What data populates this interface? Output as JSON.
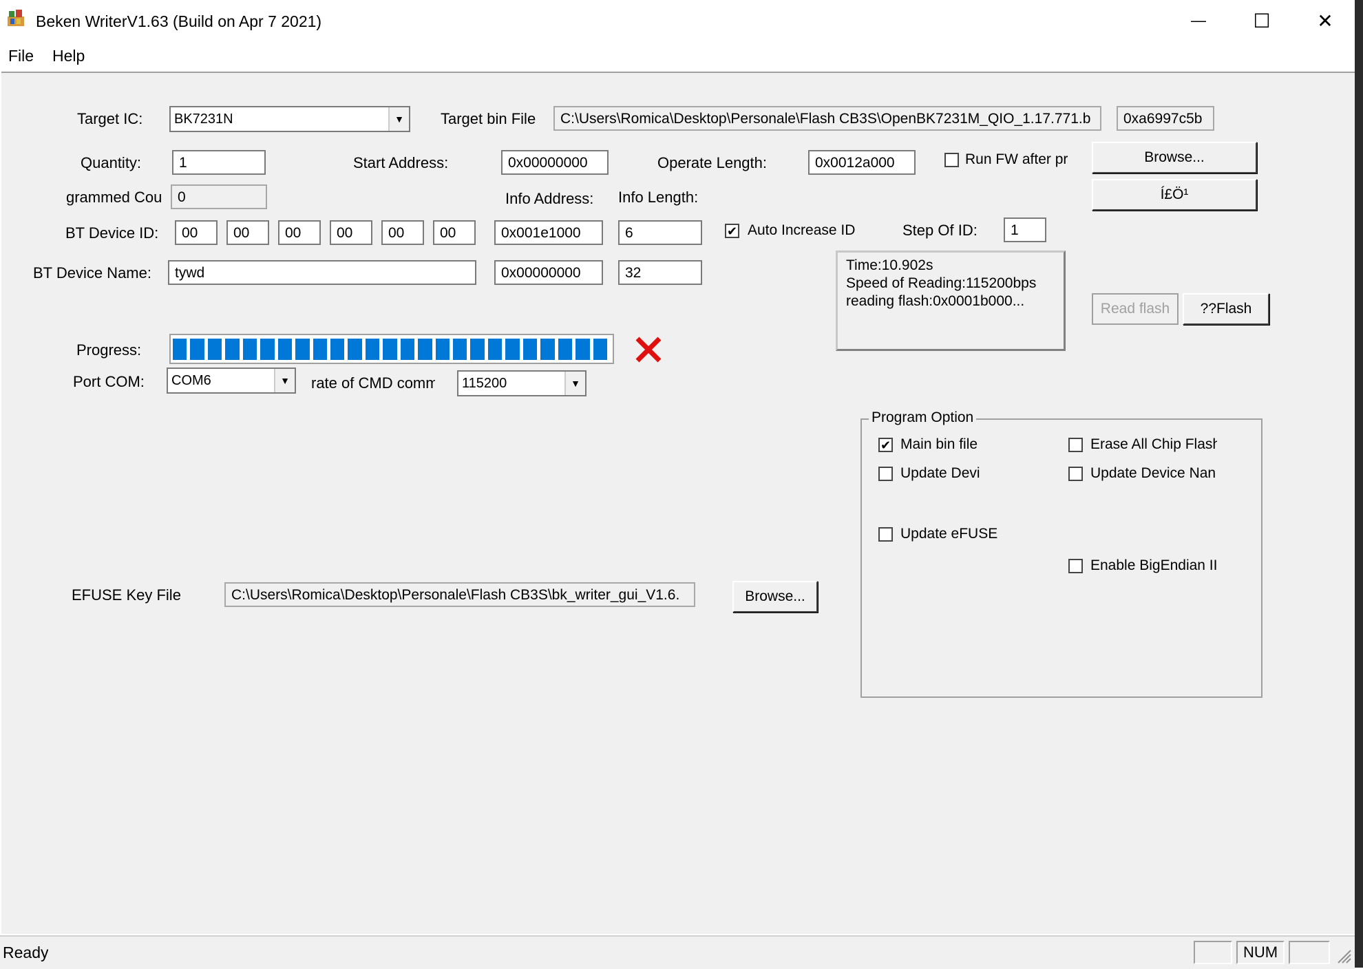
{
  "window": {
    "title": "Beken WriterV1.63 (Build on Apr  7 2021)",
    "controls": {
      "minimize": "—",
      "maximize": "☐",
      "close": "✕"
    }
  },
  "menu": {
    "file": "File",
    "help": "Help"
  },
  "form": {
    "target_ic_label": "Target IC:",
    "target_ic_value": "BK7231N",
    "target_bin_label": "Target bin File",
    "target_bin_value": "C:\\Users\\Romica\\Desktop\\Personale\\Flash CB3S\\OpenBK7231M_QIO_1.17.771.b",
    "crc_value": "0xa6997c5b",
    "quantity_label": "Quantity:",
    "quantity_value": "1",
    "start_address_label": "Start Address:",
    "start_address_value": "0x00000000",
    "operate_length_label": "Operate Length:",
    "operate_length_value": "0x0012a000",
    "run_fw_label": "Run FW after pr",
    "programmed_count_label": "grammed Coun",
    "programmed_count_value": "0",
    "info_address_label": "Info Address:",
    "info_length_label": "Info Length:",
    "bt_device_id_label": "BT Device ID:",
    "bt_device_id": [
      "00",
      "00",
      "00",
      "00",
      "00",
      "00"
    ],
    "info_address_1": "0x001e1000",
    "info_length_1": "6",
    "auto_increase_label": "Auto Increase ID",
    "step_of_id_label": "Step Of ID:",
    "step_of_id_value": "1",
    "bt_device_name_label": "BT Device Name:",
    "bt_device_name_value": "tywd",
    "info_address_2": "0x00000000",
    "info_length_2": "32",
    "progress_label": "Progress:",
    "port_com_label": "Port COM:",
    "port_com_value": "COM6",
    "cmd_rate_label": "rate of CMD comm.",
    "cmd_rate_value": "115200",
    "efuse_label": "EFUSE Key File",
    "efuse_value": "C:\\Users\\Romica\\Desktop\\Personale\\Flash CB3S\\bk_writer_gui_V1.6."
  },
  "buttons": {
    "browse_top": "Browse...",
    "garbled": "Í£Ö¹",
    "read_flash": "Read flash",
    "flash": "??Flash",
    "browse_efuse": "Browse..."
  },
  "log": {
    "lines": [
      "Time:10.902s",
      "Speed of Reading:115200bps",
      "reading flash:0x0001b000..."
    ]
  },
  "progress": {
    "fraction": 1.0,
    "segments": 25
  },
  "program_option": {
    "title": "Program Option",
    "main_bin": "Main bin file",
    "erase_all": "Erase All Chip Flash",
    "update_device_id": "Update Devi",
    "update_device_name": "Update Device Nan",
    "update_efuse": "Update eFUSE",
    "big_endian": "Enable BigEndian II"
  },
  "status": {
    "text": "Ready",
    "num": "NUM"
  },
  "colors": {
    "accent": "#0078d7",
    "stop": "#e01010"
  }
}
